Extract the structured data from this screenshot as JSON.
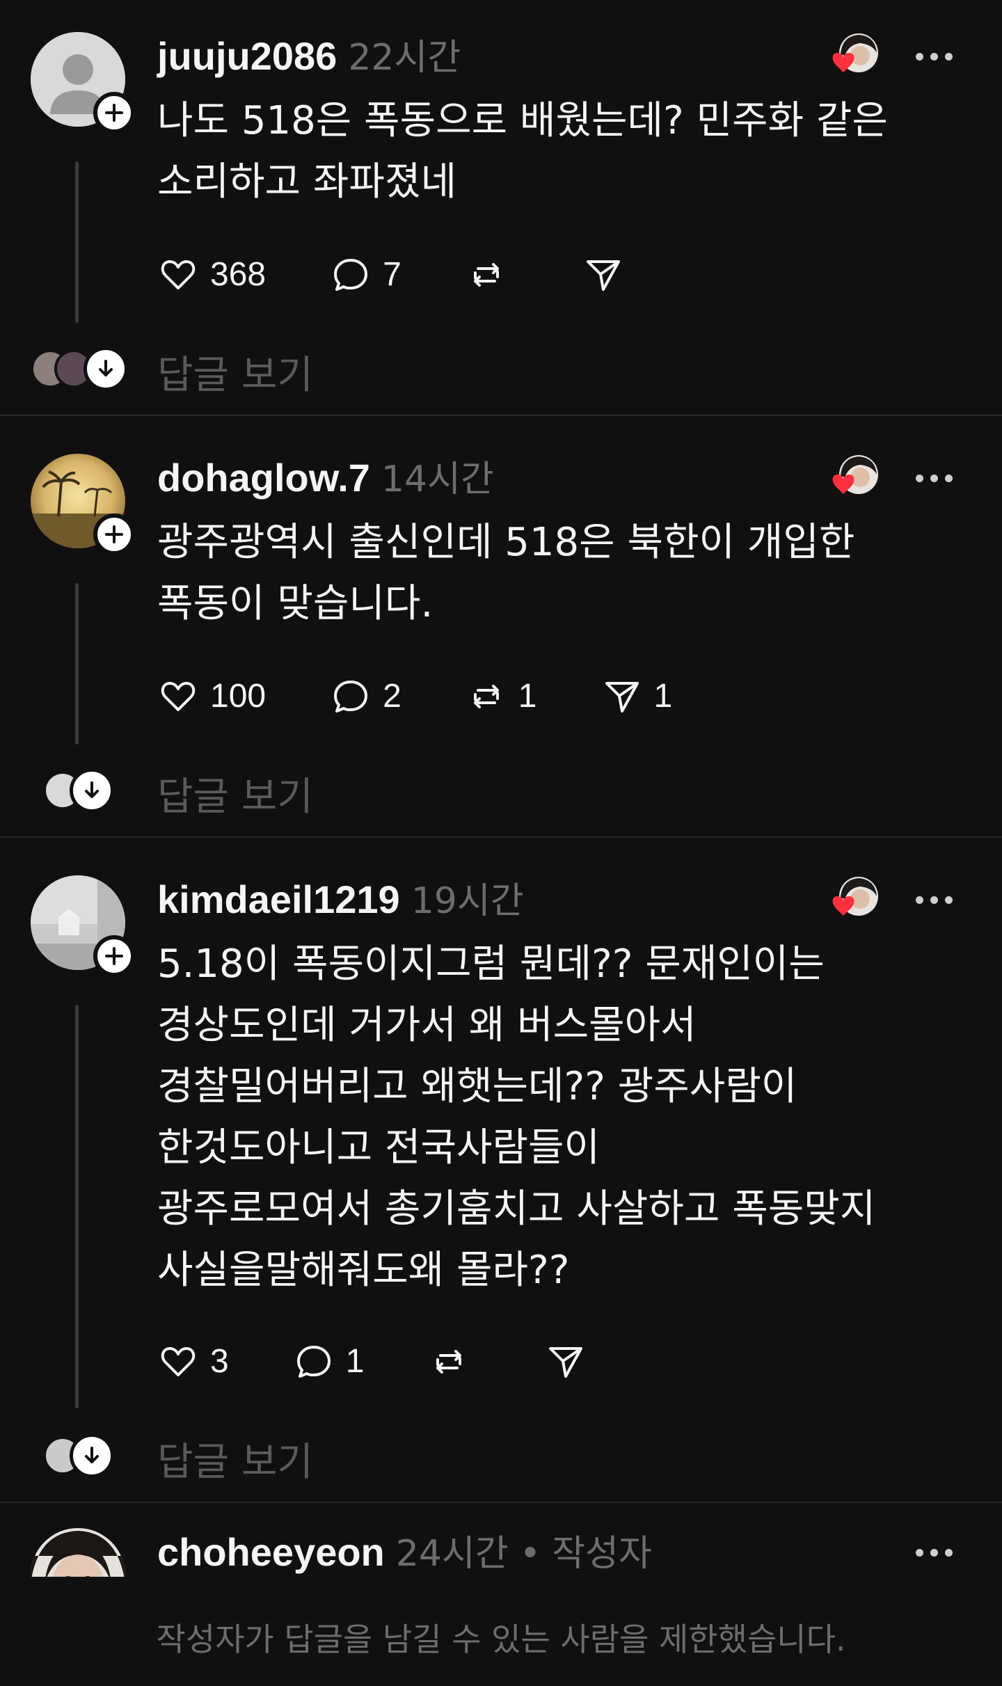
{
  "posts": [
    {
      "username": "juuju2086",
      "time": "22시간",
      "lines": [
        "나도 518은 폭동으로 배웠는데?  민주화 같은",
        "소리하고  좌파졌네"
      ],
      "likes": "368",
      "comments": "7",
      "reposts": "",
      "shares": "",
      "view_replies": "답글 보기"
    },
    {
      "username": "dohaglow.7",
      "time": "14시간",
      "lines": [
        "광주광역시 출신인데 518은 북한이 개입한",
        "폭동이 맞습니다."
      ],
      "likes": "100",
      "comments": "2",
      "reposts": "1",
      "shares": "1",
      "view_replies": "답글 보기"
    },
    {
      "username": "kimdaeil1219",
      "time": "19시간",
      "lines": [
        "5.18이 폭동이지그럼 뭔데?? 문재인이는",
        "경상도인데 거가서 왜 버스몰아서",
        "경찰밀어버리고 왜햇는데?? 광주사람이",
        "한것도아니고 전국사람들이",
        "광주로모여서 총기훔치고 사살하고 폭동맞지",
        "사실을말해줘도왜 몰라??"
      ],
      "likes": "3",
      "comments": "1",
      "reposts": "",
      "shares": "",
      "view_replies": "답글 보기"
    }
  ],
  "author_post": {
    "username": "choheeyeon",
    "time": "24시간",
    "separator": "•",
    "author_tag": "작성자",
    "restricted_notice": "작성자가 답글을 남길 수 있는 사람을 제한했습니다."
  },
  "colors": {
    "background": "#101010",
    "text": "#f3f5f7",
    "muted": "#6d6d6d",
    "heart": "#ff3040"
  }
}
